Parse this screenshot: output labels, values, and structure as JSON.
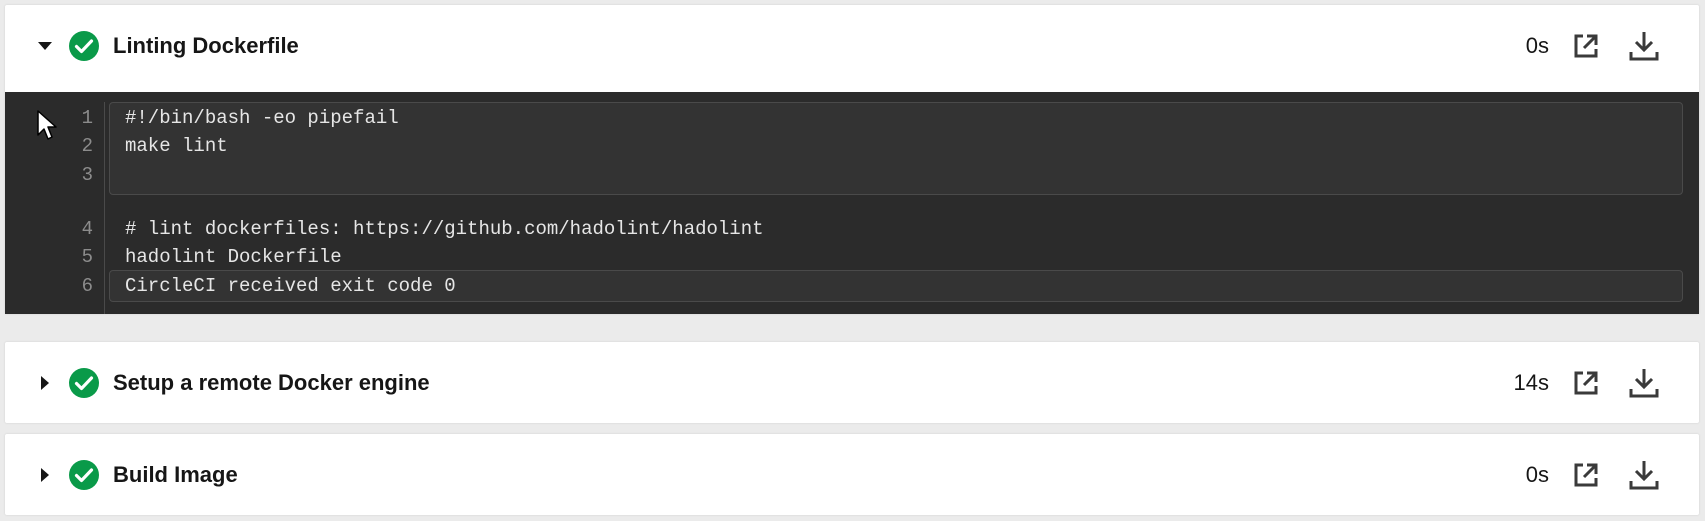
{
  "steps": [
    {
      "title": "Linting Dockerfile",
      "duration": "0s",
      "expanded": true,
      "status": "success",
      "chevron_icon": "caret-down-icon"
    },
    {
      "title": "Setup a remote Docker engine",
      "duration": "14s",
      "expanded": false,
      "status": "success",
      "chevron_icon": "caret-right-icon"
    },
    {
      "title": "Build Image",
      "duration": "0s",
      "expanded": false,
      "status": "success",
      "chevron_icon": "caret-right-icon"
    }
  ],
  "terminal": {
    "lines": [
      {
        "num": "1",
        "text": "#!/bin/bash -eo pipefail"
      },
      {
        "num": "2",
        "text": "make lint"
      },
      {
        "num": "3",
        "text": ""
      },
      {
        "num": "4",
        "text": "# lint dockerfiles: https://github.com/hadolint/hadolint"
      },
      {
        "num": "5",
        "text": "hadolint Dockerfile"
      },
      {
        "num": "6",
        "text": "CircleCI received exit code 0"
      }
    ]
  },
  "colors": {
    "success": "#0a9a49",
    "terminal_bg": "#2b2b2b",
    "page_bg": "#ebebeb",
    "text": "#161616"
  },
  "icons": {
    "status": "check-circle-icon",
    "open": "open-in-new-tab-icon",
    "download": "download-icon",
    "pointer": "mouse-cursor-icon"
  }
}
